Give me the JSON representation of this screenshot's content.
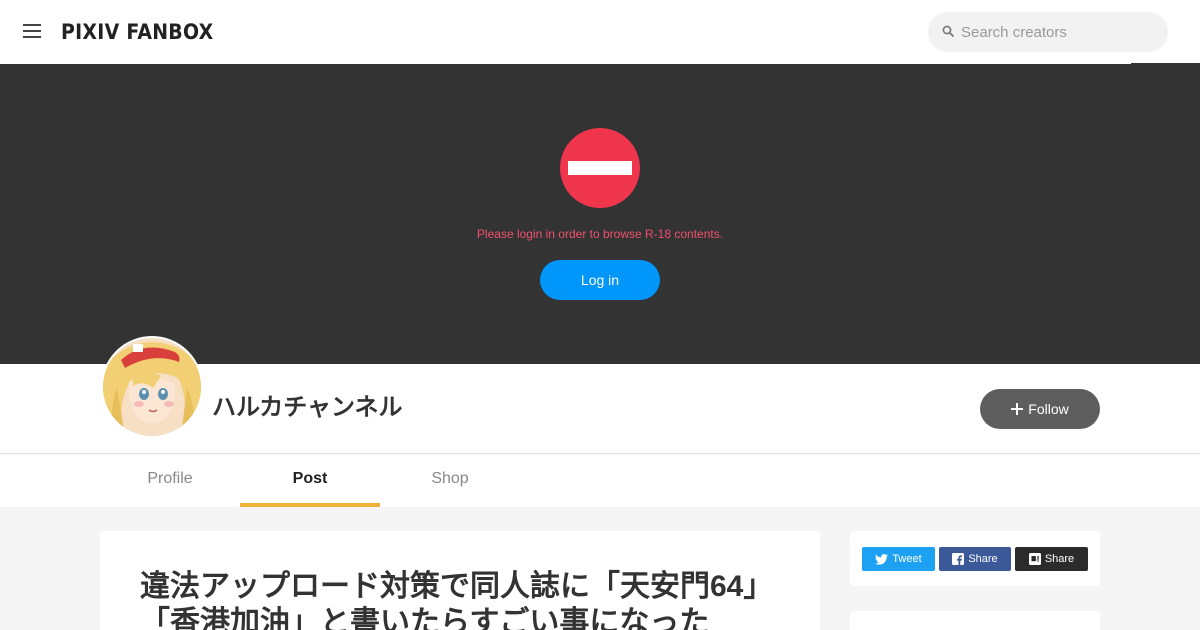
{
  "header": {
    "logo": "PIXIV FANBOX",
    "search_placeholder": "Search creators"
  },
  "banner": {
    "message": "Please login in order to browse R-18 contents.",
    "login_label": "Log in"
  },
  "creator": {
    "name": "ハルカチャンネル",
    "follow_label": "Follow"
  },
  "tabs": [
    {
      "label": "Profile",
      "active": false
    },
    {
      "label": "Post",
      "active": true
    },
    {
      "label": "Shop",
      "active": false
    }
  ],
  "post": {
    "title": "違法アップロード対策で同人誌に「天安門64」「香港加油」と書いたらすごい事になった"
  },
  "share": {
    "tweet_label": "Tweet",
    "facebook_label": "Share",
    "hatena_label": "Share"
  },
  "colors": {
    "accent_tab": "#f0b13a",
    "login_blue": "#0096fa",
    "alert_red": "#f0364c",
    "twitter": "#1da1f2",
    "facebook": "#3b5998"
  }
}
